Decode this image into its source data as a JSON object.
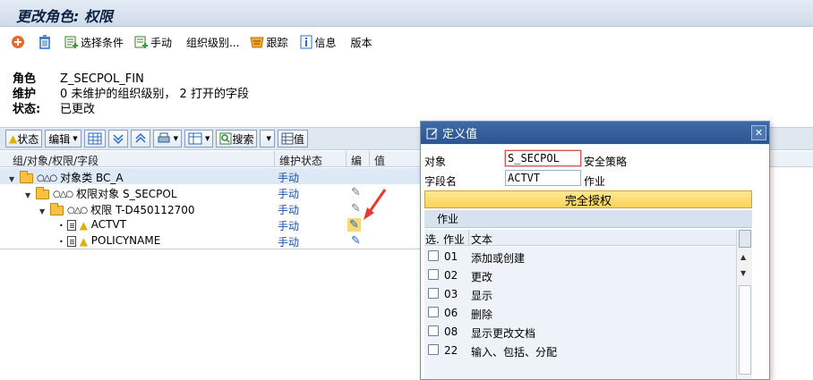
{
  "window": {
    "title": "更改角色: 权限"
  },
  "toolbar": {
    "condition_label": "选择条件",
    "manual_label": "手动",
    "org_levels_label": "组织级别...",
    "trace_label": "跟踪",
    "info_label": "信息",
    "version_label": "版本"
  },
  "info": {
    "role_label": "角色",
    "role_value": "Z_SECPOL_FIN",
    "maint_label": "维护",
    "maint_value": "0 未维护的组织级别， 2 打开的字段",
    "status_label": "状态:",
    "status_value": "已更改"
  },
  "grid_toolbar": {
    "status_btn": "状态",
    "edit_btn": "编辑",
    "search_btn": "搜索",
    "value_btn": "值"
  },
  "grid": {
    "col_tree": "组/对象/权限/字段",
    "col_status": "维护状态",
    "col_icon": "编",
    "col_value": "值",
    "rows": [
      {
        "label": "对象类 BC_A",
        "status": "手动"
      },
      {
        "label": "权限对象 S_SECPOL",
        "status": "手动"
      },
      {
        "label": "权限 T-D450112700",
        "status": "手动"
      },
      {
        "label": "ACTVT",
        "status": "手动"
      },
      {
        "label": "POLICYNAME",
        "status": "手动"
      }
    ]
  },
  "dialog": {
    "title": "定义值",
    "object_label": "对象",
    "object_value": "S_SECPOL",
    "object_desc": "安全策略",
    "field_label": "字段名",
    "field_value": "ACTVT",
    "field_desc": "作业",
    "full_auth_btn": "完全授权",
    "sub_header": "作业",
    "table": {
      "col_sel": "选.",
      "col_activity": "作业",
      "col_text": "文本",
      "rows": [
        {
          "code": "01",
          "text": "添加或创建"
        },
        {
          "code": "02",
          "text": "更改"
        },
        {
          "code": "03",
          "text": "显示"
        },
        {
          "code": "06",
          "text": "删除"
        },
        {
          "code": "08",
          "text": "显示更改文档"
        },
        {
          "code": "22",
          "text": "输入、包括、分配"
        }
      ]
    }
  },
  "colors": {
    "accent": "#2b5591",
    "status_link": "#1d4fa8",
    "highlight": "#fbd35a",
    "annotation_arrow": "#e53935"
  }
}
